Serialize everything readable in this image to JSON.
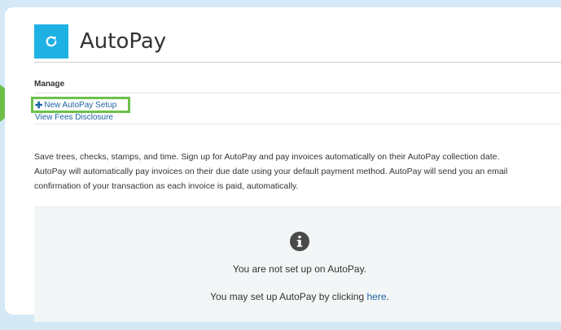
{
  "header": {
    "title": "AutoPay",
    "logo_icon": "refresh-icon",
    "logo_color": "#1eb2e4"
  },
  "manage": {
    "heading": "Manage",
    "new_setup_label": "New AutoPay Setup",
    "new_setup_icon": "plus-icon",
    "fees_label": "View Fees Disclosure",
    "highlight_color": "#6cc04a"
  },
  "description": {
    "line1": "Save trees, checks, stamps, and time. Sign up for AutoPay and pay invoices automatically on their AutoPay collection date.",
    "line2": "AutoPay will automatically pay invoices on their due date using your default payment method. AutoPay will send you an email",
    "line3": "confirmation of your transaction as each invoice is paid, automatically."
  },
  "info": {
    "icon": "info-icon",
    "status_text": "You are not set up on AutoPay.",
    "prompt_text": "You may set up AutoPay by clicking",
    "link_text": "here",
    "trailing": "."
  },
  "colors": {
    "link": "#1e62a6",
    "background": "#d4e9f5"
  }
}
